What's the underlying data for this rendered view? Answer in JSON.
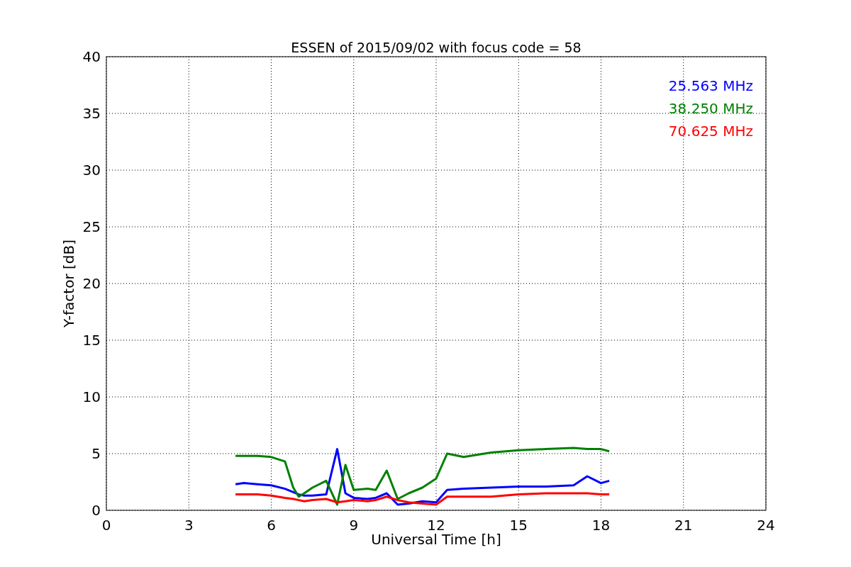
{
  "chart_data": {
    "type": "line",
    "title": "ESSEN of 2015/09/02 with focus code = 58",
    "xlabel": "Universal Time [h]",
    "ylabel": "Y-factor [dB]",
    "x": [
      4.7,
      5,
      5.5,
      6,
      6.5,
      6.8,
      7,
      7.2,
      7.5,
      8,
      8.4,
      8.7,
      9,
      9.5,
      9.8,
      10.2,
      10.6,
      11,
      11.5,
      12,
      12.4,
      13,
      14,
      15,
      16,
      17,
      17.5,
      18,
      18.3
    ],
    "series": [
      {
        "name": "25.563 MHz",
        "color": "#0000ff",
        "values": [
          2.3,
          2.4,
          2.3,
          2.2,
          1.9,
          1.6,
          1.4,
          1.3,
          1.3,
          1.4,
          5.4,
          1.5,
          1.1,
          1.0,
          1.1,
          1.5,
          0.5,
          0.6,
          0.8,
          0.7,
          1.8,
          1.9,
          2.0,
          2.1,
          2.1,
          2.2,
          3.0,
          2.4,
          2.6
        ]
      },
      {
        "name": "38.250 MHz",
        "color": "#008000",
        "values": [
          4.8,
          4.8,
          4.8,
          4.7,
          4.3,
          2.0,
          1.2,
          1.5,
          2.0,
          2.6,
          0.5,
          4.0,
          1.8,
          1.9,
          1.8,
          3.5,
          1.0,
          1.5,
          2.0,
          2.8,
          5.0,
          4.7,
          5.1,
          5.3,
          5.4,
          5.5,
          5.4,
          5.4,
          5.2
        ]
      },
      {
        "name": "70.625 MHz",
        "color": "#ff0000",
        "values": [
          1.4,
          1.4,
          1.4,
          1.3,
          1.1,
          1.0,
          0.9,
          0.8,
          0.9,
          1.0,
          0.7,
          0.8,
          0.9,
          0.8,
          0.9,
          1.2,
          0.9,
          0.7,
          0.6,
          0.5,
          1.2,
          1.2,
          1.2,
          1.4,
          1.5,
          1.5,
          1.5,
          1.4,
          1.4
        ]
      }
    ],
    "grid": true,
    "xlim": [
      0,
      24
    ],
    "ylim": [
      0,
      40
    ],
    "xticks": [
      0,
      3,
      6,
      9,
      12,
      15,
      18,
      21,
      24
    ],
    "yticks": [
      0,
      5,
      10,
      15,
      20,
      25,
      30,
      35,
      40
    ]
  }
}
